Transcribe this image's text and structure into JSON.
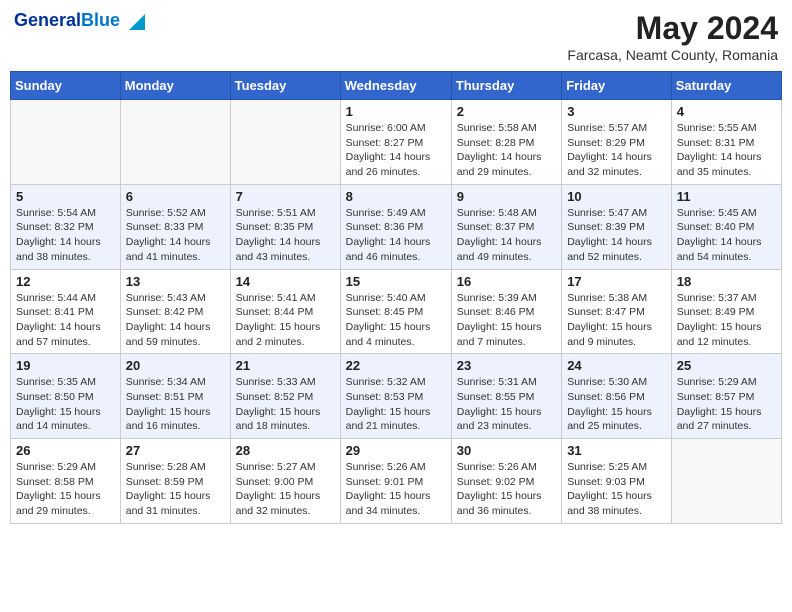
{
  "header": {
    "logo_line1": "General",
    "logo_line2": "Blue",
    "main_title": "May 2024",
    "subtitle": "Farcasa, Neamt County, Romania"
  },
  "weekdays": [
    "Sunday",
    "Monday",
    "Tuesday",
    "Wednesday",
    "Thursday",
    "Friday",
    "Saturday"
  ],
  "weeks": [
    [
      {
        "day": "",
        "info": ""
      },
      {
        "day": "",
        "info": ""
      },
      {
        "day": "",
        "info": ""
      },
      {
        "day": "1",
        "info": "Sunrise: 6:00 AM\nSunset: 8:27 PM\nDaylight: 14 hours\nand 26 minutes."
      },
      {
        "day": "2",
        "info": "Sunrise: 5:58 AM\nSunset: 8:28 PM\nDaylight: 14 hours\nand 29 minutes."
      },
      {
        "day": "3",
        "info": "Sunrise: 5:57 AM\nSunset: 8:29 PM\nDaylight: 14 hours\nand 32 minutes."
      },
      {
        "day": "4",
        "info": "Sunrise: 5:55 AM\nSunset: 8:31 PM\nDaylight: 14 hours\nand 35 minutes."
      }
    ],
    [
      {
        "day": "5",
        "info": "Sunrise: 5:54 AM\nSunset: 8:32 PM\nDaylight: 14 hours\nand 38 minutes."
      },
      {
        "day": "6",
        "info": "Sunrise: 5:52 AM\nSunset: 8:33 PM\nDaylight: 14 hours\nand 41 minutes."
      },
      {
        "day": "7",
        "info": "Sunrise: 5:51 AM\nSunset: 8:35 PM\nDaylight: 14 hours\nand 43 minutes."
      },
      {
        "day": "8",
        "info": "Sunrise: 5:49 AM\nSunset: 8:36 PM\nDaylight: 14 hours\nand 46 minutes."
      },
      {
        "day": "9",
        "info": "Sunrise: 5:48 AM\nSunset: 8:37 PM\nDaylight: 14 hours\nand 49 minutes."
      },
      {
        "day": "10",
        "info": "Sunrise: 5:47 AM\nSunset: 8:39 PM\nDaylight: 14 hours\nand 52 minutes."
      },
      {
        "day": "11",
        "info": "Sunrise: 5:45 AM\nSunset: 8:40 PM\nDaylight: 14 hours\nand 54 minutes."
      }
    ],
    [
      {
        "day": "12",
        "info": "Sunrise: 5:44 AM\nSunset: 8:41 PM\nDaylight: 14 hours\nand 57 minutes."
      },
      {
        "day": "13",
        "info": "Sunrise: 5:43 AM\nSunset: 8:42 PM\nDaylight: 14 hours\nand 59 minutes."
      },
      {
        "day": "14",
        "info": "Sunrise: 5:41 AM\nSunset: 8:44 PM\nDaylight: 15 hours\nand 2 minutes."
      },
      {
        "day": "15",
        "info": "Sunrise: 5:40 AM\nSunset: 8:45 PM\nDaylight: 15 hours\nand 4 minutes."
      },
      {
        "day": "16",
        "info": "Sunrise: 5:39 AM\nSunset: 8:46 PM\nDaylight: 15 hours\nand 7 minutes."
      },
      {
        "day": "17",
        "info": "Sunrise: 5:38 AM\nSunset: 8:47 PM\nDaylight: 15 hours\nand 9 minutes."
      },
      {
        "day": "18",
        "info": "Sunrise: 5:37 AM\nSunset: 8:49 PM\nDaylight: 15 hours\nand 12 minutes."
      }
    ],
    [
      {
        "day": "19",
        "info": "Sunrise: 5:35 AM\nSunset: 8:50 PM\nDaylight: 15 hours\nand 14 minutes."
      },
      {
        "day": "20",
        "info": "Sunrise: 5:34 AM\nSunset: 8:51 PM\nDaylight: 15 hours\nand 16 minutes."
      },
      {
        "day": "21",
        "info": "Sunrise: 5:33 AM\nSunset: 8:52 PM\nDaylight: 15 hours\nand 18 minutes."
      },
      {
        "day": "22",
        "info": "Sunrise: 5:32 AM\nSunset: 8:53 PM\nDaylight: 15 hours\nand 21 minutes."
      },
      {
        "day": "23",
        "info": "Sunrise: 5:31 AM\nSunset: 8:55 PM\nDaylight: 15 hours\nand 23 minutes."
      },
      {
        "day": "24",
        "info": "Sunrise: 5:30 AM\nSunset: 8:56 PM\nDaylight: 15 hours\nand 25 minutes."
      },
      {
        "day": "25",
        "info": "Sunrise: 5:29 AM\nSunset: 8:57 PM\nDaylight: 15 hours\nand 27 minutes."
      }
    ],
    [
      {
        "day": "26",
        "info": "Sunrise: 5:29 AM\nSunset: 8:58 PM\nDaylight: 15 hours\nand 29 minutes."
      },
      {
        "day": "27",
        "info": "Sunrise: 5:28 AM\nSunset: 8:59 PM\nDaylight: 15 hours\nand 31 minutes."
      },
      {
        "day": "28",
        "info": "Sunrise: 5:27 AM\nSunset: 9:00 PM\nDaylight: 15 hours\nand 32 minutes."
      },
      {
        "day": "29",
        "info": "Sunrise: 5:26 AM\nSunset: 9:01 PM\nDaylight: 15 hours\nand 34 minutes."
      },
      {
        "day": "30",
        "info": "Sunrise: 5:26 AM\nSunset: 9:02 PM\nDaylight: 15 hours\nand 36 minutes."
      },
      {
        "day": "31",
        "info": "Sunrise: 5:25 AM\nSunset: 9:03 PM\nDaylight: 15 hours\nand 38 minutes."
      },
      {
        "day": "",
        "info": ""
      }
    ]
  ]
}
